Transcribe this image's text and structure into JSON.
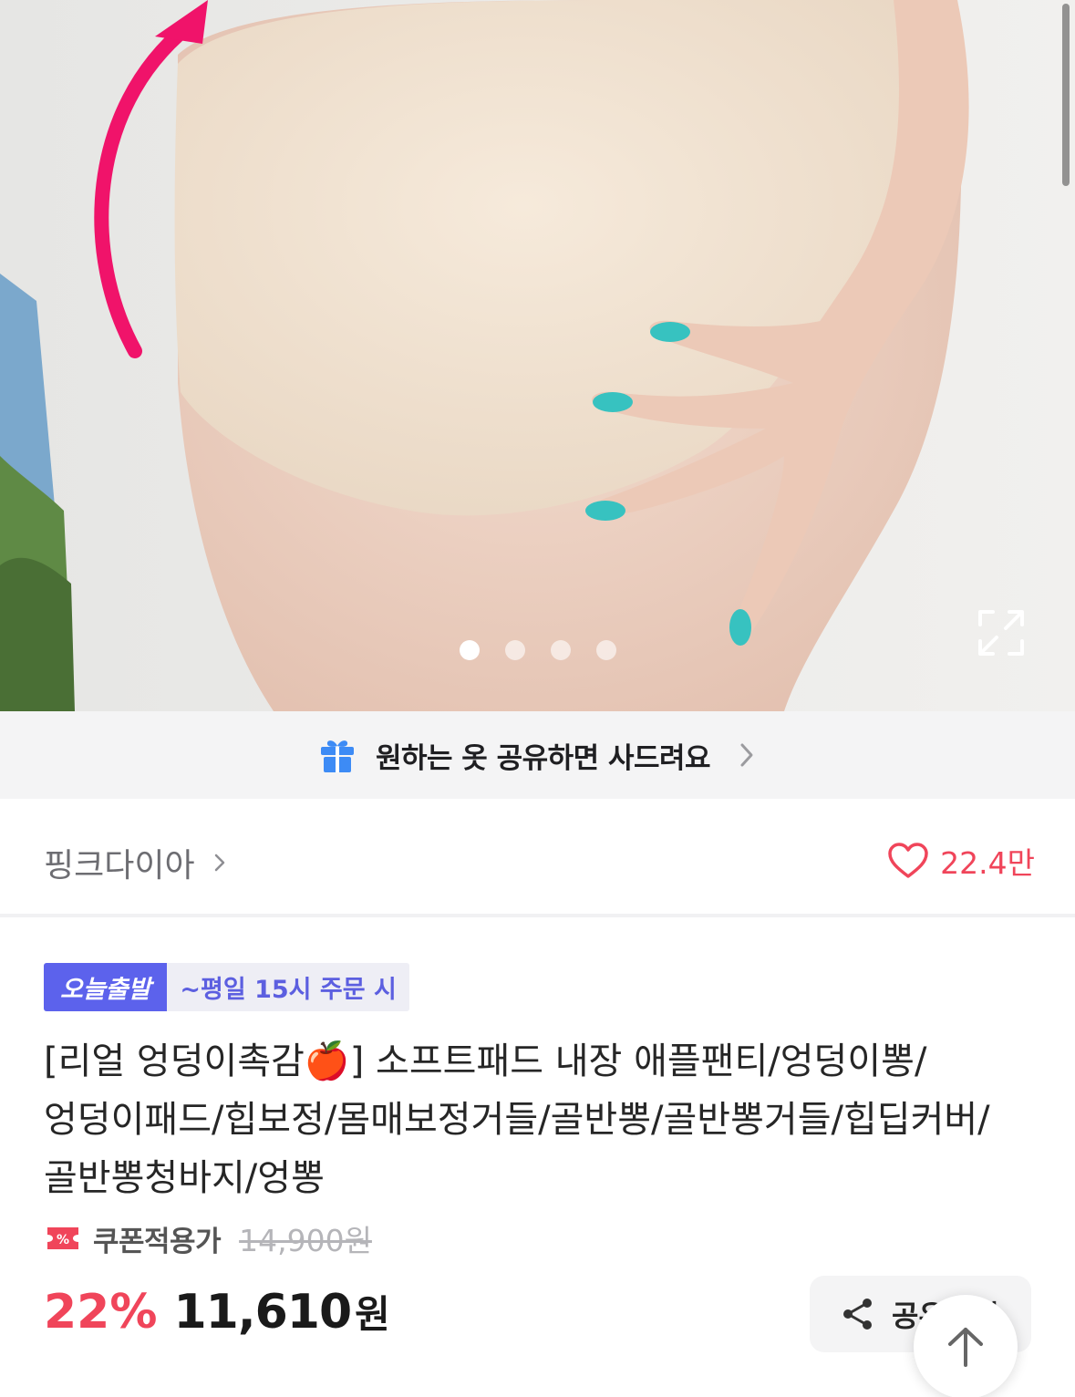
{
  "gallery": {
    "page_count": 4,
    "active_index": 0,
    "expand_icon": "expand-icon"
  },
  "gift_banner": {
    "icon": "gift-icon",
    "text": "원하는 옷 공유하면 사드려요",
    "chevron_icon": "chevron-right-icon"
  },
  "store": {
    "name": "핑크다이아",
    "like_icon": "heart-outline-icon",
    "like_count": "22.4만"
  },
  "delivery": {
    "badge": "오늘출발",
    "note": "~평일 15시 주문 시"
  },
  "product": {
    "title": "[리얼 엉덩이촉감🍎] 소프트패드 내장 애플팬티/엉덩이뽕/엉덩이패드/힙보정/몸매보정거들/골반뽕/골반뽕거들/힙딥커버/골반뽕청바지/엉뽕"
  },
  "pricing": {
    "coupon_icon": "coupon-percent-icon",
    "coupon_label": "쿠폰적용가",
    "original_price": "14,900원",
    "discount": "22%",
    "price": "11,610",
    "price_unit": "원"
  },
  "share": {
    "icon": "share-icon",
    "label": "공유하기"
  },
  "scroll_top": {
    "icon": "arrow-up-icon"
  },
  "colors": {
    "accent_red": "#f0455a",
    "badge_purple": "#5c62ec",
    "gift_blue": "#3d8bf5"
  }
}
